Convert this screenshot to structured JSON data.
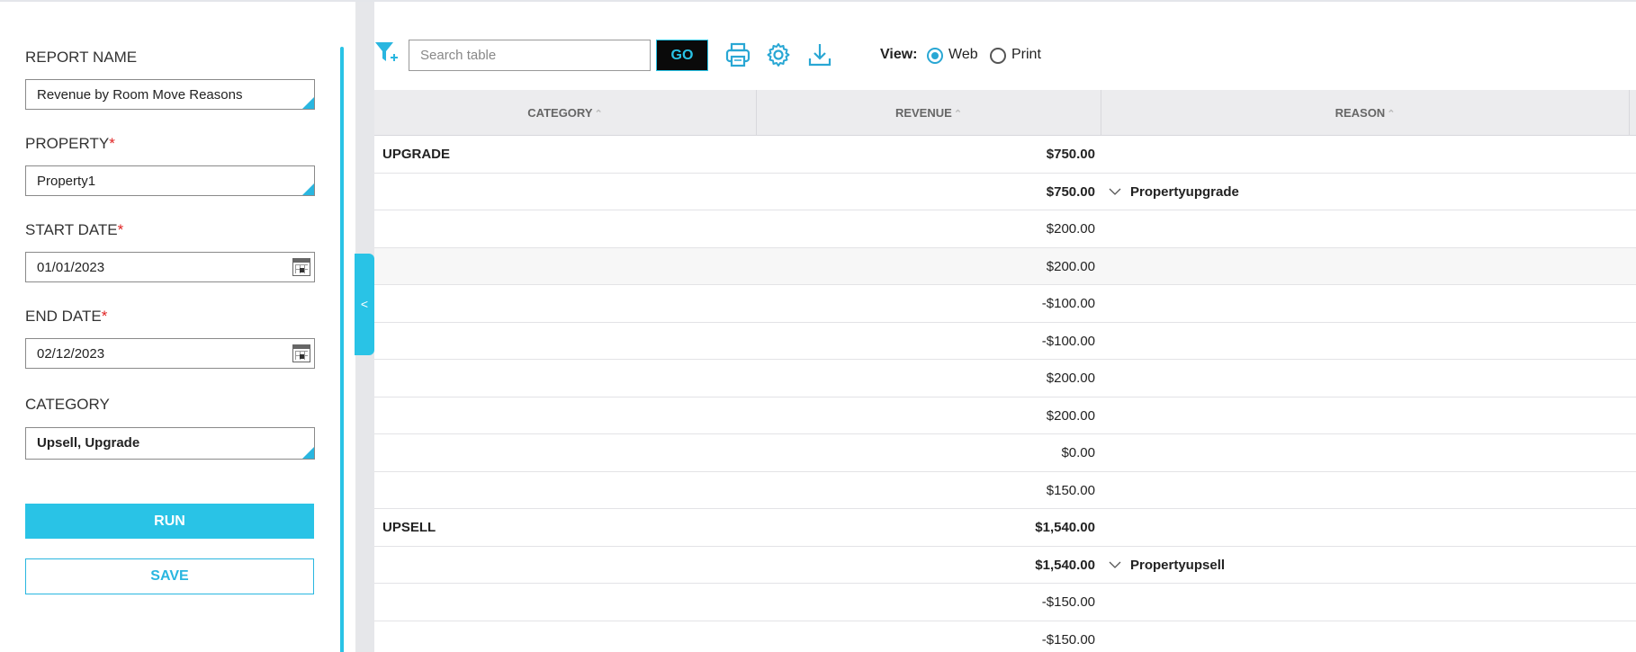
{
  "sidebar": {
    "report_name_label": "REPORT NAME",
    "report_name_value": "Revenue by Room Move Reasons",
    "property_label": "PROPERTY",
    "property_value": "Property1",
    "start_date_label": "START DATE",
    "start_date_value": "01/01/2023",
    "end_date_label": "END DATE",
    "end_date_value": "02/12/2023",
    "category_label": "CATEGORY",
    "category_value": "Upsell, Upgrade",
    "required_mark": "*",
    "run_label": "RUN",
    "save_label": "SAVE",
    "collapse_label": "<"
  },
  "toolbar": {
    "search_placeholder": "Search table",
    "go_label": "GO",
    "view_label": "View:",
    "view_options": [
      "Web",
      "Print"
    ],
    "view_selected": "Web",
    "icons": [
      "filter-add-icon",
      "print-icon",
      "settings-gear-icon",
      "download-icon"
    ]
  },
  "table": {
    "columns": [
      "CATEGORY",
      "REVENUE",
      "REASON"
    ],
    "rows": [
      {
        "category": "UPGRADE",
        "revenue": "$750.00",
        "reason": "",
        "group": true
      },
      {
        "category": "",
        "revenue": "$750.00",
        "reason": "Propertyupgrade",
        "subgroup": true
      },
      {
        "category": "",
        "revenue": "$200.00",
        "reason": ""
      },
      {
        "category": "",
        "revenue": "$200.00",
        "reason": ""
      },
      {
        "category": "",
        "revenue": "-$100.00",
        "reason": ""
      },
      {
        "category": "",
        "revenue": "-$100.00",
        "reason": ""
      },
      {
        "category": "",
        "revenue": "$200.00",
        "reason": ""
      },
      {
        "category": "",
        "revenue": "$200.00",
        "reason": ""
      },
      {
        "category": "",
        "revenue": "$0.00",
        "reason": ""
      },
      {
        "category": "",
        "revenue": "$150.00",
        "reason": ""
      },
      {
        "category": "UPSELL",
        "revenue": "$1,540.00",
        "reason": "",
        "group": true
      },
      {
        "category": "",
        "revenue": "$1,540.00",
        "reason": "Propertyupsell",
        "subgroup": true
      },
      {
        "category": "",
        "revenue": "-$150.00",
        "reason": ""
      },
      {
        "category": "",
        "revenue": "-$150.00",
        "reason": ""
      }
    ]
  },
  "colors": {
    "accent": "#29c3e6",
    "required": "#e02424"
  }
}
